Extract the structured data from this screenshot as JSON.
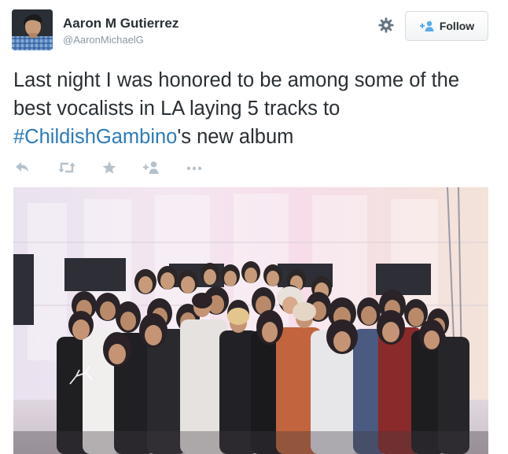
{
  "user": {
    "name": "Aaron M Gutierrez",
    "handle": "@AaronMichaelG",
    "avatar_icon": "user-avatar"
  },
  "follow_button": {
    "label": "Follow",
    "icon": "add-user-icon"
  },
  "settings_icon": "gear-icon",
  "tweet": {
    "text_part1": "Last night I was honored to be among some of the best vocalists in LA laying 5 tracks to ",
    "hashtag": "#ChildishGambino",
    "text_part2": "'s new album"
  },
  "actions": [
    {
      "name": "reply",
      "icon": "reply-icon"
    },
    {
      "name": "retweet",
      "icon": "retweet-icon"
    },
    {
      "name": "favorite",
      "icon": "star-icon"
    },
    {
      "name": "follow",
      "icon": "add-user-icon"
    },
    {
      "name": "more",
      "icon": "more-icon"
    }
  ],
  "photo": {
    "subject": "group-photo-recording-studio"
  },
  "colors": {
    "link": "#2b7bb9",
    "text": "#292f33",
    "secondary": "#8899a6",
    "action_icon": "#b6c2cb",
    "follow_icon": "#55acee"
  }
}
